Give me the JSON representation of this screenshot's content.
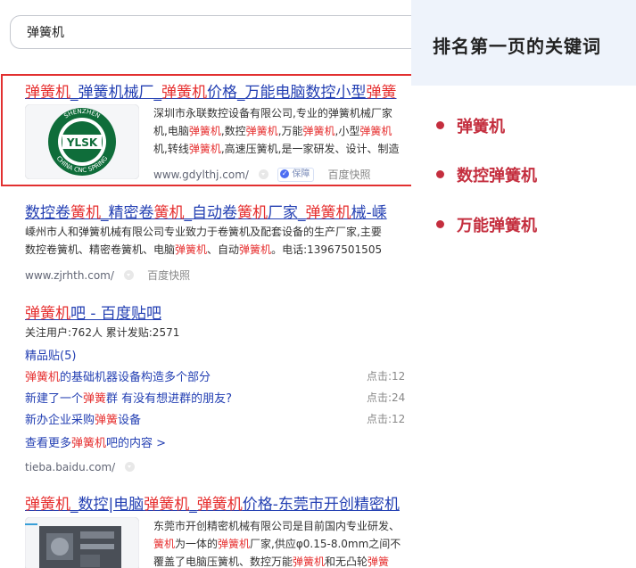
{
  "search": {
    "query": "弹簧机"
  },
  "result1": {
    "title_parts": [
      "弹簧机",
      "_弹簧机械厂_",
      "弹簧机",
      "价格_万能电脑数控小型",
      "弹簧"
    ],
    "desc_lines": [
      [
        "深圳市永联数控设备有限公司,专业的弹簧机械厂家"
      ],
      [
        "机,电脑",
        "弹簧机",
        ",数控",
        "弹簧机",
        ",万能",
        "弹簧机",
        ",小型",
        "弹簧机"
      ],
      [
        "机,转线",
        "弹簧机",
        ",高速压簧机,是一家研发、设计、制造"
      ]
    ],
    "url": "www.gdylthj.com/",
    "badge": "保障",
    "snapshot": "百度快照",
    "logo_text": "YLSK",
    "logo_ring_top": "SHENZHEN",
    "logo_ring_bottom": "CHINA CNC SPRING"
  },
  "result2": {
    "title_parts": [
      "数控卷",
      "簧机",
      "_精密卷",
      "簧机",
      "_自动卷",
      "簧机",
      "厂家_",
      "弹簧机",
      "械-嵊"
    ],
    "desc_line1": "嵊州市人和弹簧机械有限公司专业致力于卷簧机及配套设备的生产厂家,主要",
    "desc_line2": [
      "数控卷簧机、精密卷簧机、电脑",
      "弹簧机",
      "、自动",
      "弹簧机",
      "。电话:13967501505"
    ],
    "url": "www.zjrhth.com/",
    "snapshot": "百度快照"
  },
  "result3": {
    "title_parts": [
      "弹簧机",
      "吧 - 百度贴吧"
    ],
    "stats": "关注用户:762人    累计发贴:2571",
    "featured": "精品贴(5)",
    "posts": [
      {
        "parts": [
          "弹簧机",
          "的基础机器设备构造多个部分"
        ],
        "clicks": "点击:12"
      },
      {
        "parts": [
          "新建了一个",
          "弹簧",
          "群 有没有想进群的朋友?"
        ],
        "clicks": "点击:24"
      },
      {
        "parts": [
          "新办企业采购",
          "弹簧",
          "设备"
        ],
        "clicks": "点击:12"
      }
    ],
    "more_parts": [
      "查看更多",
      "弹簧机",
      "吧的内容 >"
    ],
    "url": "tieba.baidu.com/"
  },
  "result4": {
    "title_parts": [
      "弹簧机",
      "_数控|电脑",
      "弹簧机",
      "_",
      "弹簧机",
      "价格-东莞市开创精密机"
    ],
    "desc_line1": "东莞市开创精密机械有限公司是目前国内专业研发、",
    "desc_line2": [
      "簧机",
      "为一体的",
      "弹簧机",
      "厂家,供应φ0.15-8.0mm之间不"
    ],
    "desc_line3": [
      "覆盖了电脑压簧机、数控万能",
      "弹簧机",
      "和无凸轮",
      "弹簧"
    ]
  },
  "panel": {
    "title": "排名第一页的关键词",
    "keywords": [
      "弹簧机",
      "数控弹簧机",
      "万能弹簧机"
    ]
  },
  "colors": {
    "highlight": "#e62e2e",
    "link": "#2440b3",
    "panel_bg": "#eef3fb",
    "keyword": "#c42e3e",
    "box": "#e23030"
  }
}
